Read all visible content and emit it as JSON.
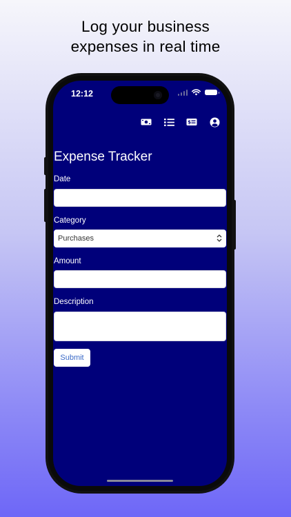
{
  "promo": {
    "headline_line1": "Log your business",
    "headline_line2": "expenses in real time"
  },
  "status_bar": {
    "time": "12:12"
  },
  "navbar": {
    "icons": [
      "cash-icon",
      "list-icon",
      "dollar-card-icon",
      "account-icon"
    ]
  },
  "form": {
    "title": "Expense Tracker",
    "date_label": "Date",
    "date_value": "",
    "category_label": "Category",
    "category_selected": "Purchases",
    "amount_label": "Amount",
    "amount_value": "",
    "description_label": "Description",
    "description_value": "",
    "submit_label": "Submit"
  },
  "colors": {
    "screen_background": "#00007a",
    "submit_text": "#3a6ac7",
    "page_gradient_bottom": "#6e67f7"
  }
}
